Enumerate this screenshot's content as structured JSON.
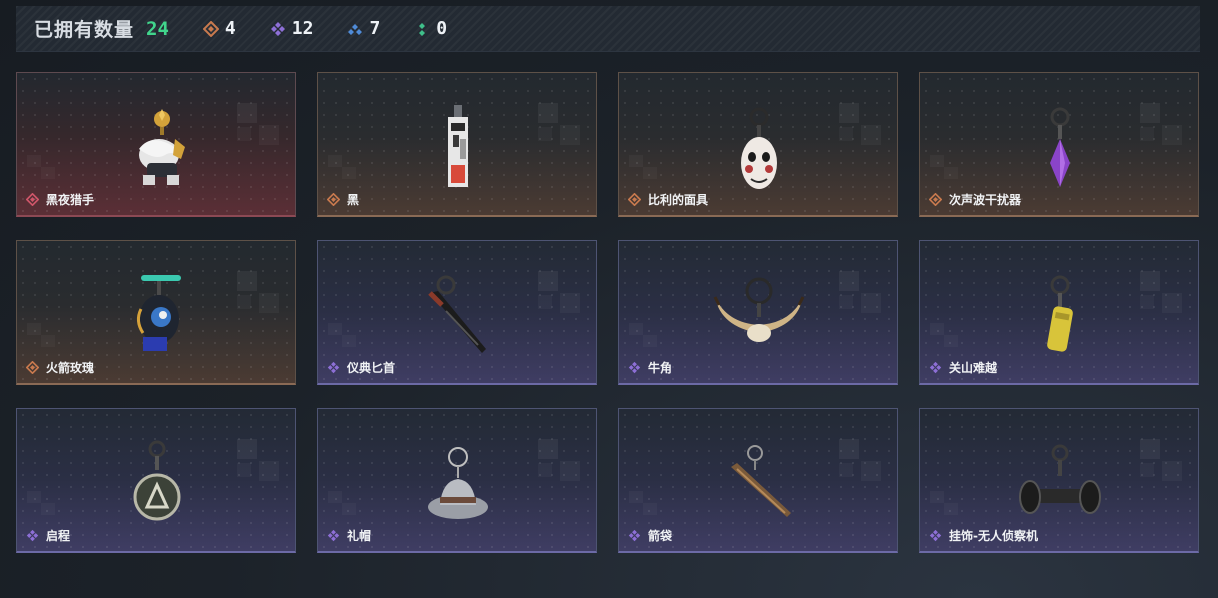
{
  "header": {
    "owned_label": "已拥有数量",
    "owned_count": "24",
    "rarity_counts": [
      {
        "icon": "orange-diamond-icon",
        "color": "#c97a4e",
        "count": "4"
      },
      {
        "icon": "purple-diamond-icon",
        "color": "#8d6fd6",
        "count": "12"
      },
      {
        "icon": "blue-diamond-icon",
        "color": "#4f8bd8",
        "count": "7"
      },
      {
        "icon": "green-diamond-icon",
        "color": "#3fbf8a",
        "count": "0"
      }
    ]
  },
  "items": [
    {
      "name": "黑夜猎手",
      "rarity": "red",
      "icon": "night-hunter-charm-icon"
    },
    {
      "name": "黑",
      "rarity": "orange",
      "icon": "black-tag-charm-icon"
    },
    {
      "name": "比利的面具",
      "rarity": "orange",
      "icon": "billy-mask-charm-icon"
    },
    {
      "name": "次声波干扰器",
      "rarity": "orange",
      "icon": "crystal-jammer-charm-icon"
    },
    {
      "name": "火箭玫瑰",
      "rarity": "orange",
      "icon": "rocket-rose-charm-icon"
    },
    {
      "name": "仪典匕首",
      "rarity": "purple",
      "icon": "ceremonial-dagger-charm-icon"
    },
    {
      "name": "牛角",
      "rarity": "purple",
      "icon": "horns-charm-icon"
    },
    {
      "name": "关山难越",
      "rarity": "purple",
      "icon": "yellow-capsule-charm-icon"
    },
    {
      "name": "启程",
      "rarity": "purple",
      "icon": "medal-charm-icon"
    },
    {
      "name": "礼帽",
      "rarity": "purple",
      "icon": "hat-charm-icon"
    },
    {
      "name": "箭袋",
      "rarity": "purple",
      "icon": "quiver-charm-icon"
    },
    {
      "name": "挂饰-无人侦察机",
      "rarity": "purple",
      "icon": "recon-drone-charm-icon"
    }
  ],
  "colors": {
    "red": "#d0566a",
    "orange": "#c97a4e",
    "purple": "#8d6fd6",
    "owned_count": "#41d58c"
  }
}
